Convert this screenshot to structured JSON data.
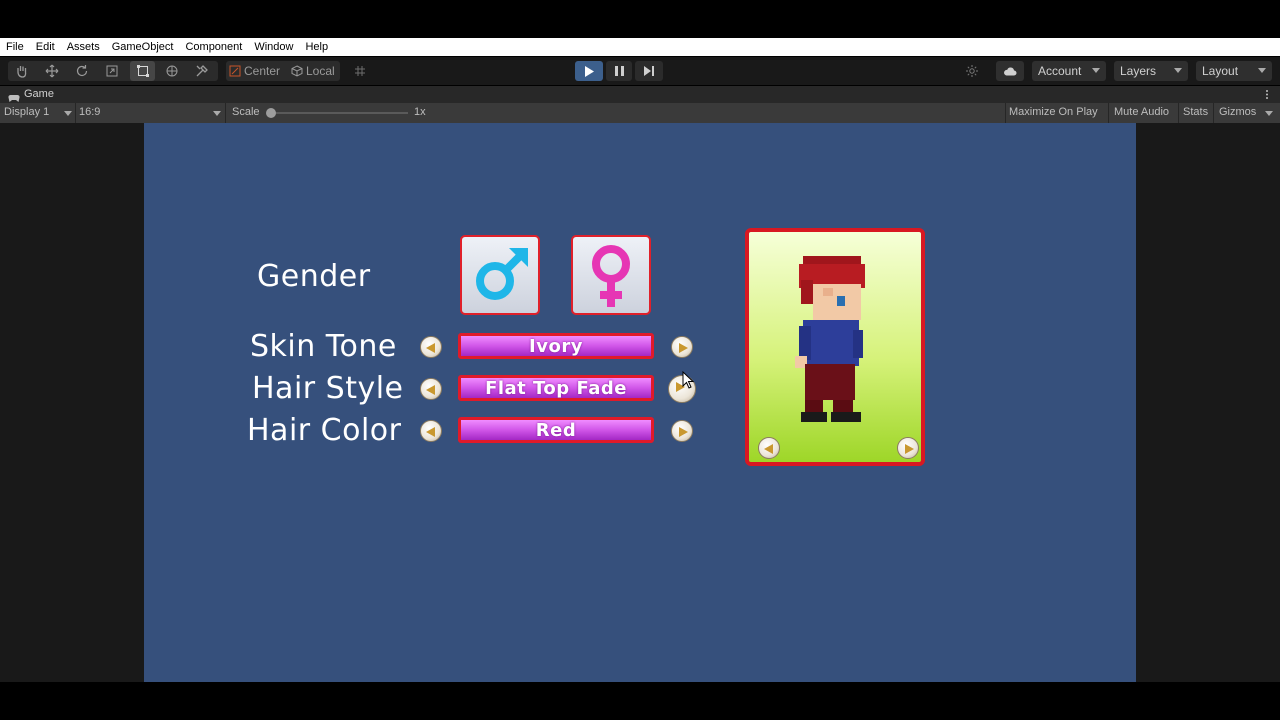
{
  "menu": [
    "File",
    "Edit",
    "Assets",
    "GameObject",
    "Component",
    "Window",
    "Help"
  ],
  "toolbar": {
    "center_label": "Center",
    "local_label": "Local",
    "account_label": "Account",
    "layers_label": "Layers",
    "layout_label": "Layout"
  },
  "game_tab": {
    "title": "Game",
    "display": "Display 1",
    "aspect": "16:9",
    "scale_label": "Scale",
    "scale_value": "1x",
    "maximize": "Maximize On Play",
    "mute": "Mute Audio",
    "stats": "Stats",
    "gizmos": "Gizmos"
  },
  "game": {
    "gender_label": "Gender",
    "rows": [
      {
        "label": "Skin Tone",
        "value": "Ivory"
      },
      {
        "label": "Hair Style",
        "value": "Flat Top Fade"
      },
      {
        "label": "Hair Color",
        "value": "Red"
      }
    ],
    "male_color": "#1fb6e8",
    "female_color": "#e636b4"
  },
  "colors": {
    "game_bg": "#36507c",
    "accent_red": "#e01a2a",
    "bar_purple": "#c44ee0"
  }
}
